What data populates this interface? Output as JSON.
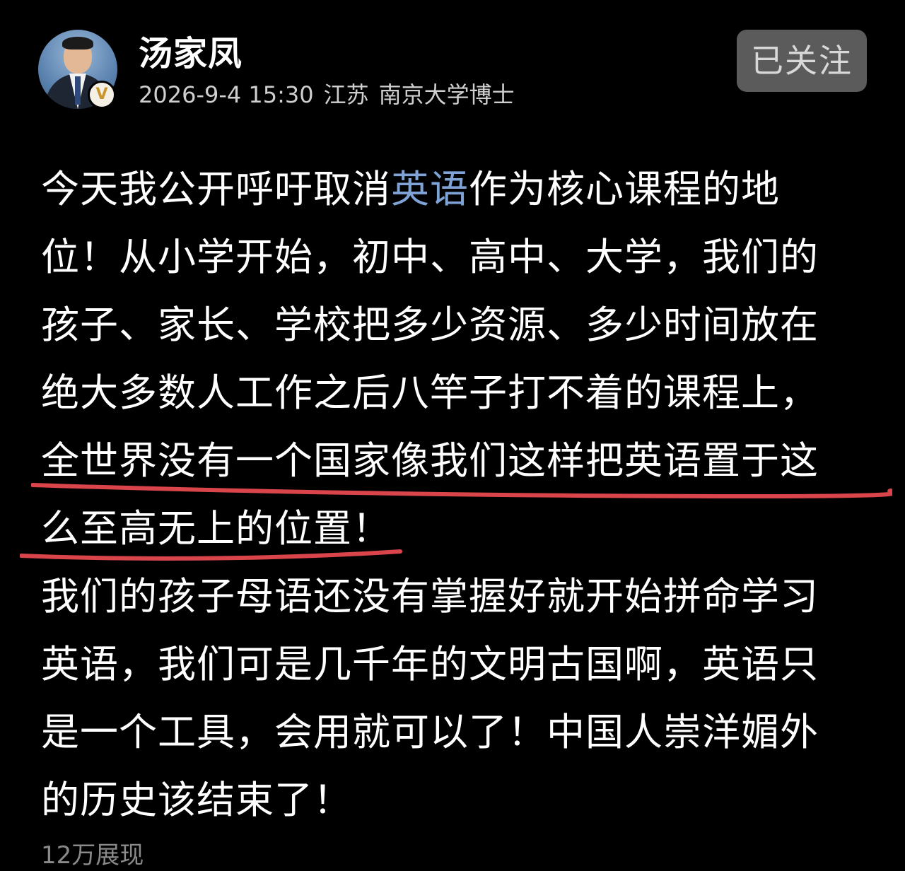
{
  "post": {
    "author": {
      "name": "汤家凤",
      "verified_badge": "V",
      "date": "2026-9-4 15:30",
      "location": "江苏",
      "title": "南京大学博士"
    },
    "follow_button_label": "已关注",
    "lines": [
      {
        "before": "今天我公开呼吁取消",
        "link": "英语",
        "after": "作为核心课程的地"
      },
      {
        "text": "位！从小学开始，初中、高中、大学，我们的"
      },
      {
        "text": "孩子、家长、学校把多少资源、多少时间放在"
      },
      {
        "text": "绝大多数人工作之后八竿子打不着的课程上，"
      },
      {
        "text": "全世界没有一个国家像我们这样把英语置于这"
      },
      {
        "text": "么至高无上的位置！"
      },
      {
        "text": "我们的孩子母语还没有掌握好就开始拼命学习"
      },
      {
        "text": "英语，我们可是几千年的文明古国啊，英语只"
      },
      {
        "text": "是一个工具，会用就可以了！中国人崇洋媚外"
      },
      {
        "text": "的历史该结束了！"
      }
    ],
    "views": "12万展现"
  },
  "colors": {
    "background": "#000000",
    "text": "#ffffff",
    "meta_text": "#cfcfcf",
    "link_text": "#7fa3d6",
    "follow_button_bg": "#5b5b5b",
    "underline": "#d9454a"
  },
  "icons": {
    "avatar": "person-photo-avatar",
    "badge": "verified-v-badge"
  }
}
